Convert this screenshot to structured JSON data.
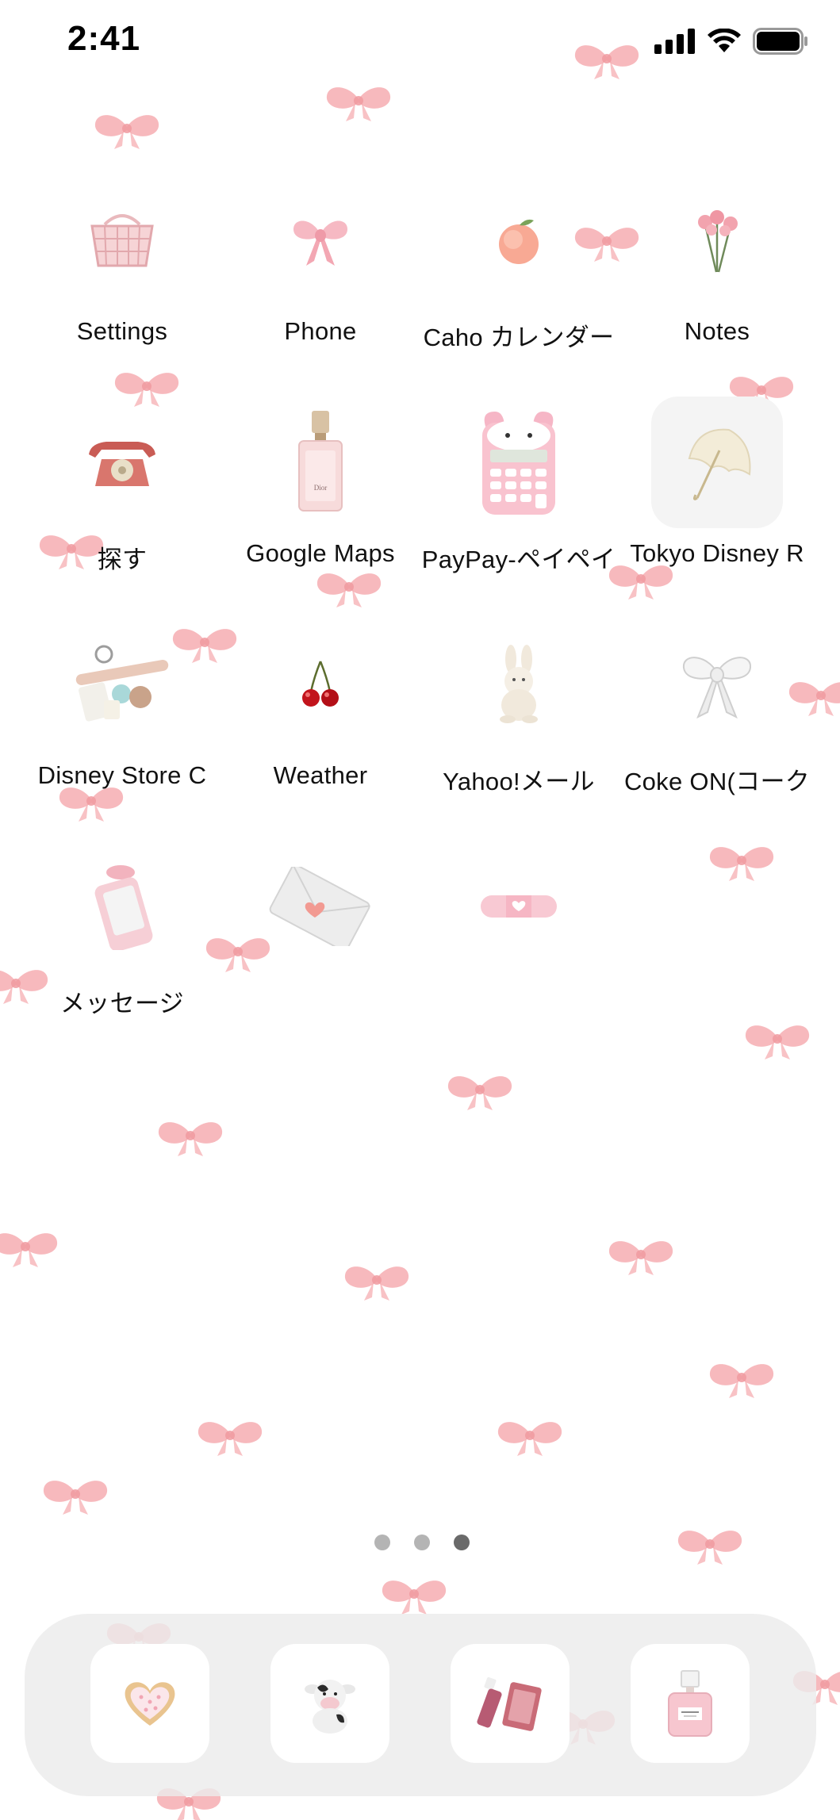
{
  "status_bar": {
    "time": "2:41",
    "signal_icon": "cellular-signal-icon",
    "wifi_icon": "wifi-icon",
    "battery_icon": "battery-full-icon"
  },
  "apps": [
    {
      "label": "Settings",
      "icon": "shopping-basket-icon"
    },
    {
      "label": "Phone",
      "icon": "pink-ribbon-bow-icon"
    },
    {
      "label": "Caho カレンダー",
      "icon": "peach-icon"
    },
    {
      "label": "Notes",
      "icon": "pink-roses-icon"
    },
    {
      "label": "探す",
      "icon": "rotary-phone-icon"
    },
    {
      "label": "Google Maps",
      "icon": "perfume-bottle-icon"
    },
    {
      "label": "PayPay-ペイペイ",
      "icon": "calculator-icon"
    },
    {
      "label": "Tokyo Disney R",
      "icon": "parasol-icon"
    },
    {
      "label": "Disney Store C",
      "icon": "cosmetics-icon"
    },
    {
      "label": "Weather",
      "icon": "cherries-icon"
    },
    {
      "label": "Yahoo!メール",
      "icon": "plush-bunny-icon"
    },
    {
      "label": "Coke ON(コーク",
      "icon": "white-bow-icon"
    },
    {
      "label": "メッセージ",
      "icon": "pink-phone-icon"
    },
    {
      "label": "",
      "icon": "envelope-heart-icon"
    },
    {
      "label": "",
      "icon": "bandage-heart-icon"
    }
  ],
  "page_indicator": {
    "count": 3,
    "active": 3
  },
  "dock": [
    {
      "icon": "heart-cookie-icon"
    },
    {
      "icon": "cow-plush-icon"
    },
    {
      "icon": "lip-gloss-cards-icon"
    },
    {
      "icon": "perfume-chanel-icon"
    }
  ],
  "colors": {
    "wallpaper": "#ffffff",
    "bow_pink": "#f5a8ad",
    "dock_background": "#ececec",
    "label_text": "#111111"
  }
}
